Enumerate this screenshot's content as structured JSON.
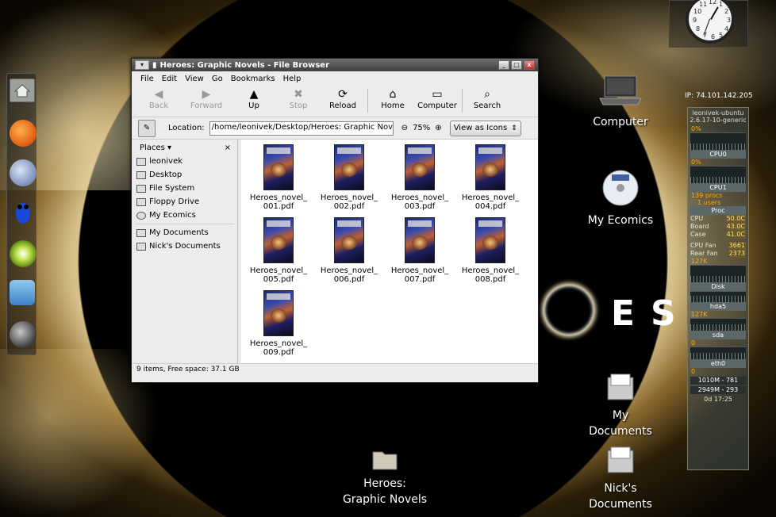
{
  "window": {
    "title": "Heroes: Graphic Novels - File Browser",
    "controls": {
      "minimize": "_",
      "maximize": "□",
      "close": "x"
    }
  },
  "menu": [
    "File",
    "Edit",
    "View",
    "Go",
    "Bookmarks",
    "Help"
  ],
  "toolbar": {
    "back": "Back",
    "forward": "Forward",
    "up": "Up",
    "stop": "Stop",
    "reload": "Reload",
    "home": "Home",
    "computer": "Computer",
    "search": "Search"
  },
  "location": {
    "label": "Location:",
    "path": "/home/leonivek/Desktop/Heroes: Graphic Novels",
    "zoom": "75%",
    "view_mode": "View as Icons"
  },
  "places": {
    "header": "Places",
    "close": "×",
    "items": [
      "leonivek",
      "Desktop",
      "File System",
      "Floppy Drive",
      "My Ecomics"
    ],
    "bookmarks": [
      "My Documents",
      "Nick's Documents"
    ]
  },
  "files": [
    {
      "name1": "Heroes_novel_",
      "name2": "001.pdf"
    },
    {
      "name1": "Heroes_novel_",
      "name2": "002.pdf"
    },
    {
      "name1": "Heroes_novel_",
      "name2": "003.pdf"
    },
    {
      "name1": "Heroes_novel_",
      "name2": "004.pdf"
    },
    {
      "name1": "Heroes_novel_",
      "name2": "005.pdf"
    },
    {
      "name1": "Heroes_novel_",
      "name2": "006.pdf"
    },
    {
      "name1": "Heroes_novel_",
      "name2": "007.pdf"
    },
    {
      "name1": "Heroes_novel_",
      "name2": "008.pdf"
    },
    {
      "name1": "Heroes_novel_",
      "name2": "009.pdf"
    }
  ],
  "status": "9 items, Free space: 37.1 GB",
  "desktop": {
    "computer": "Computer",
    "ecomics": "My Ecomics",
    "mydocs": "My Documents",
    "nicks_line1": "Nick's",
    "nicks_line2": "Documents",
    "heroes_line1": "Heroes:",
    "heroes_line2": "Graphic Novels"
  },
  "wallpaper": {
    "letter_e": "E",
    "letter_s": "S"
  },
  "clock": {
    "numbers": [
      "12",
      "1",
      "2",
      "3",
      "4",
      "5",
      "6",
      "7",
      "8",
      "9",
      "10",
      "11"
    ]
  },
  "monitor": {
    "ip": "IP: 74.101.142.205",
    "host": "leonivek-ubuntu",
    "kernel": "2.6.17-10-generic",
    "cpu0_pct": "0%",
    "cpu0": "CPU0",
    "cpu1_pct": "0%",
    "cpu1": "CPU1",
    "procs": "139 procs",
    "users": "1 users",
    "proc": "Proc",
    "cpu_temp_label": "CPU",
    "cpu_temp": "50.0C",
    "board_label": "Board",
    "board_temp": "43.0C",
    "case_label": "Case",
    "case_temp": "41.0C",
    "cpufan_label": "CPU Fan",
    "cpufan": "3661",
    "rearfan_label": "Rear Fan",
    "rearfan": "2373",
    "disk_max": "127K",
    "disk": "Disk",
    "hda5": "hda5",
    "hda5_max": "127K",
    "sda": "sda",
    "sda_val": "0",
    "eth0": "eth0",
    "eth0_val": "0",
    "mem1": "1010M - 781",
    "mem2": "2949M - 293",
    "uptime": "0d 17:25"
  },
  "colors": {
    "window_bg": "#ececec",
    "titlebar": "#4e4e4e",
    "monitor_value": "#ffdd88"
  }
}
